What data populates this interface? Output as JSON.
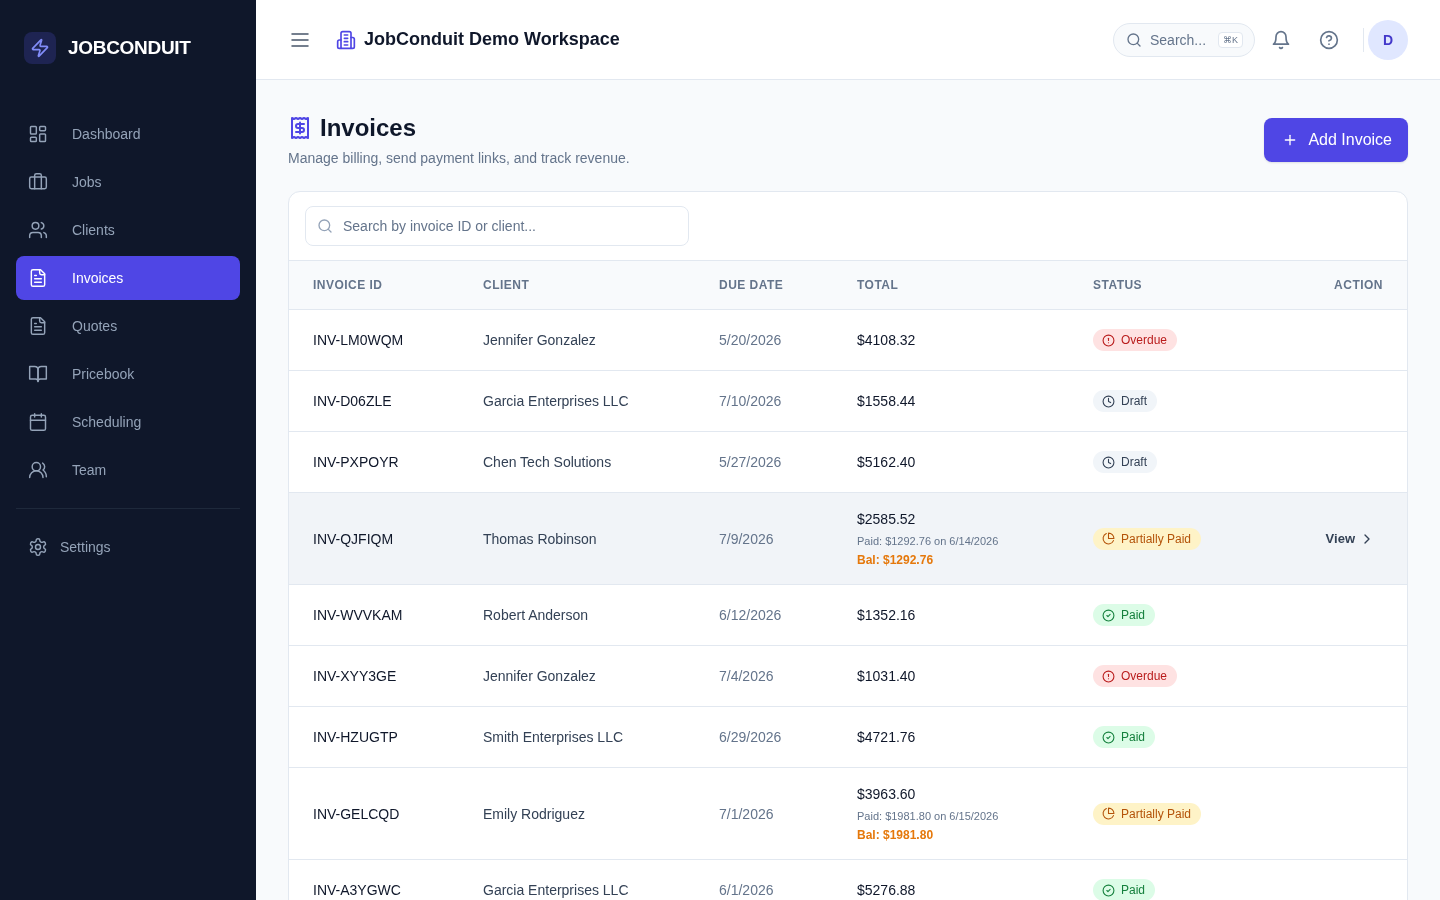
{
  "sidebar": {
    "brand": "JOBCONDUIT",
    "items": [
      {
        "label": "Dashboard",
        "selected": false
      },
      {
        "label": "Jobs",
        "selected": false
      },
      {
        "label": "Clients",
        "selected": false
      },
      {
        "label": "Invoices",
        "selected": true
      },
      {
        "label": "Quotes",
        "selected": false
      },
      {
        "label": "Pricebook",
        "selected": false
      },
      {
        "label": "Scheduling",
        "selected": false
      },
      {
        "label": "Team",
        "selected": false
      }
    ],
    "footer_items": [
      {
        "label": "Settings",
        "selected": false
      }
    ]
  },
  "header": {
    "title": "JobConduit Demo Workspace",
    "search": {
      "placeholder": "Search...",
      "shortcut": "⌘K"
    },
    "avatar": "D"
  },
  "page": {
    "title": "Invoices",
    "subtitle": "Manage billing, send payment links, and track revenue.",
    "add_button": "Add Invoice"
  },
  "table": {
    "search": {
      "placeholder": "Search by invoice ID or client..."
    },
    "columns": [
      "INVOICE ID",
      "CLIENT",
      "DUE DATE",
      "TOTAL",
      "STATUS",
      "ACTION"
    ],
    "rows": [
      {
        "invoice_id": "INV-LM0WQM",
        "client": "Jennifer Gonzalez",
        "due_date": "5/20/2026",
        "total": "$4108.32",
        "status": {
          "kind": "overdue",
          "label": "Overdue"
        },
        "hovered": false
      },
      {
        "invoice_id": "INV-D06ZLE",
        "client": "Garcia Enterprises LLC",
        "due_date": "7/10/2026",
        "total": "$1558.44",
        "status": {
          "kind": "draft",
          "label": "Draft"
        },
        "hovered": false
      },
      {
        "invoice_id": "INV-PXPOYR",
        "client": "Chen Tech Solutions",
        "due_date": "5/27/2026",
        "total": "$5162.40",
        "status": {
          "kind": "draft",
          "label": "Draft"
        },
        "hovered": false
      },
      {
        "invoice_id": "INV-QJFIQM",
        "client": "Thomas Robinson",
        "due_date": "7/9/2026",
        "total": "$2585.52",
        "paid_note": "Paid: $1292.76 on 6/14/2026",
        "balance": "Bal: $1292.76",
        "status": {
          "kind": "partial",
          "label": "Partially Paid"
        },
        "hovered": true,
        "action": "View"
      },
      {
        "invoice_id": "INV-WVVKAM",
        "client": "Robert Anderson",
        "due_date": "6/12/2026",
        "total": "$1352.16",
        "status": {
          "kind": "paid",
          "label": "Paid"
        },
        "hovered": false
      },
      {
        "invoice_id": "INV-XYY3GE",
        "client": "Jennifer Gonzalez",
        "due_date": "7/4/2026",
        "total": "$1031.40",
        "status": {
          "kind": "overdue",
          "label": "Overdue"
        },
        "hovered": false
      },
      {
        "invoice_id": "INV-HZUGTP",
        "client": "Smith Enterprises LLC",
        "due_date": "6/29/2026",
        "total": "$4721.76",
        "status": {
          "kind": "paid",
          "label": "Paid"
        },
        "hovered": false
      },
      {
        "invoice_id": "INV-GELCQD",
        "client": "Emily Rodriguez",
        "due_date": "7/1/2026",
        "total": "$3963.60",
        "paid_note": "Paid: $1981.80 on 6/15/2026",
        "balance": "Bal: $1981.80",
        "status": {
          "kind": "partial",
          "label": "Partially Paid"
        },
        "hovered": false
      },
      {
        "invoice_id": "INV-A3YGWC",
        "client": "Garcia Enterprises LLC",
        "due_date": "6/1/2026",
        "total": "$5276.88",
        "status": {
          "kind": "paid",
          "label": "Paid"
        },
        "hovered": false
      }
    ]
  }
}
